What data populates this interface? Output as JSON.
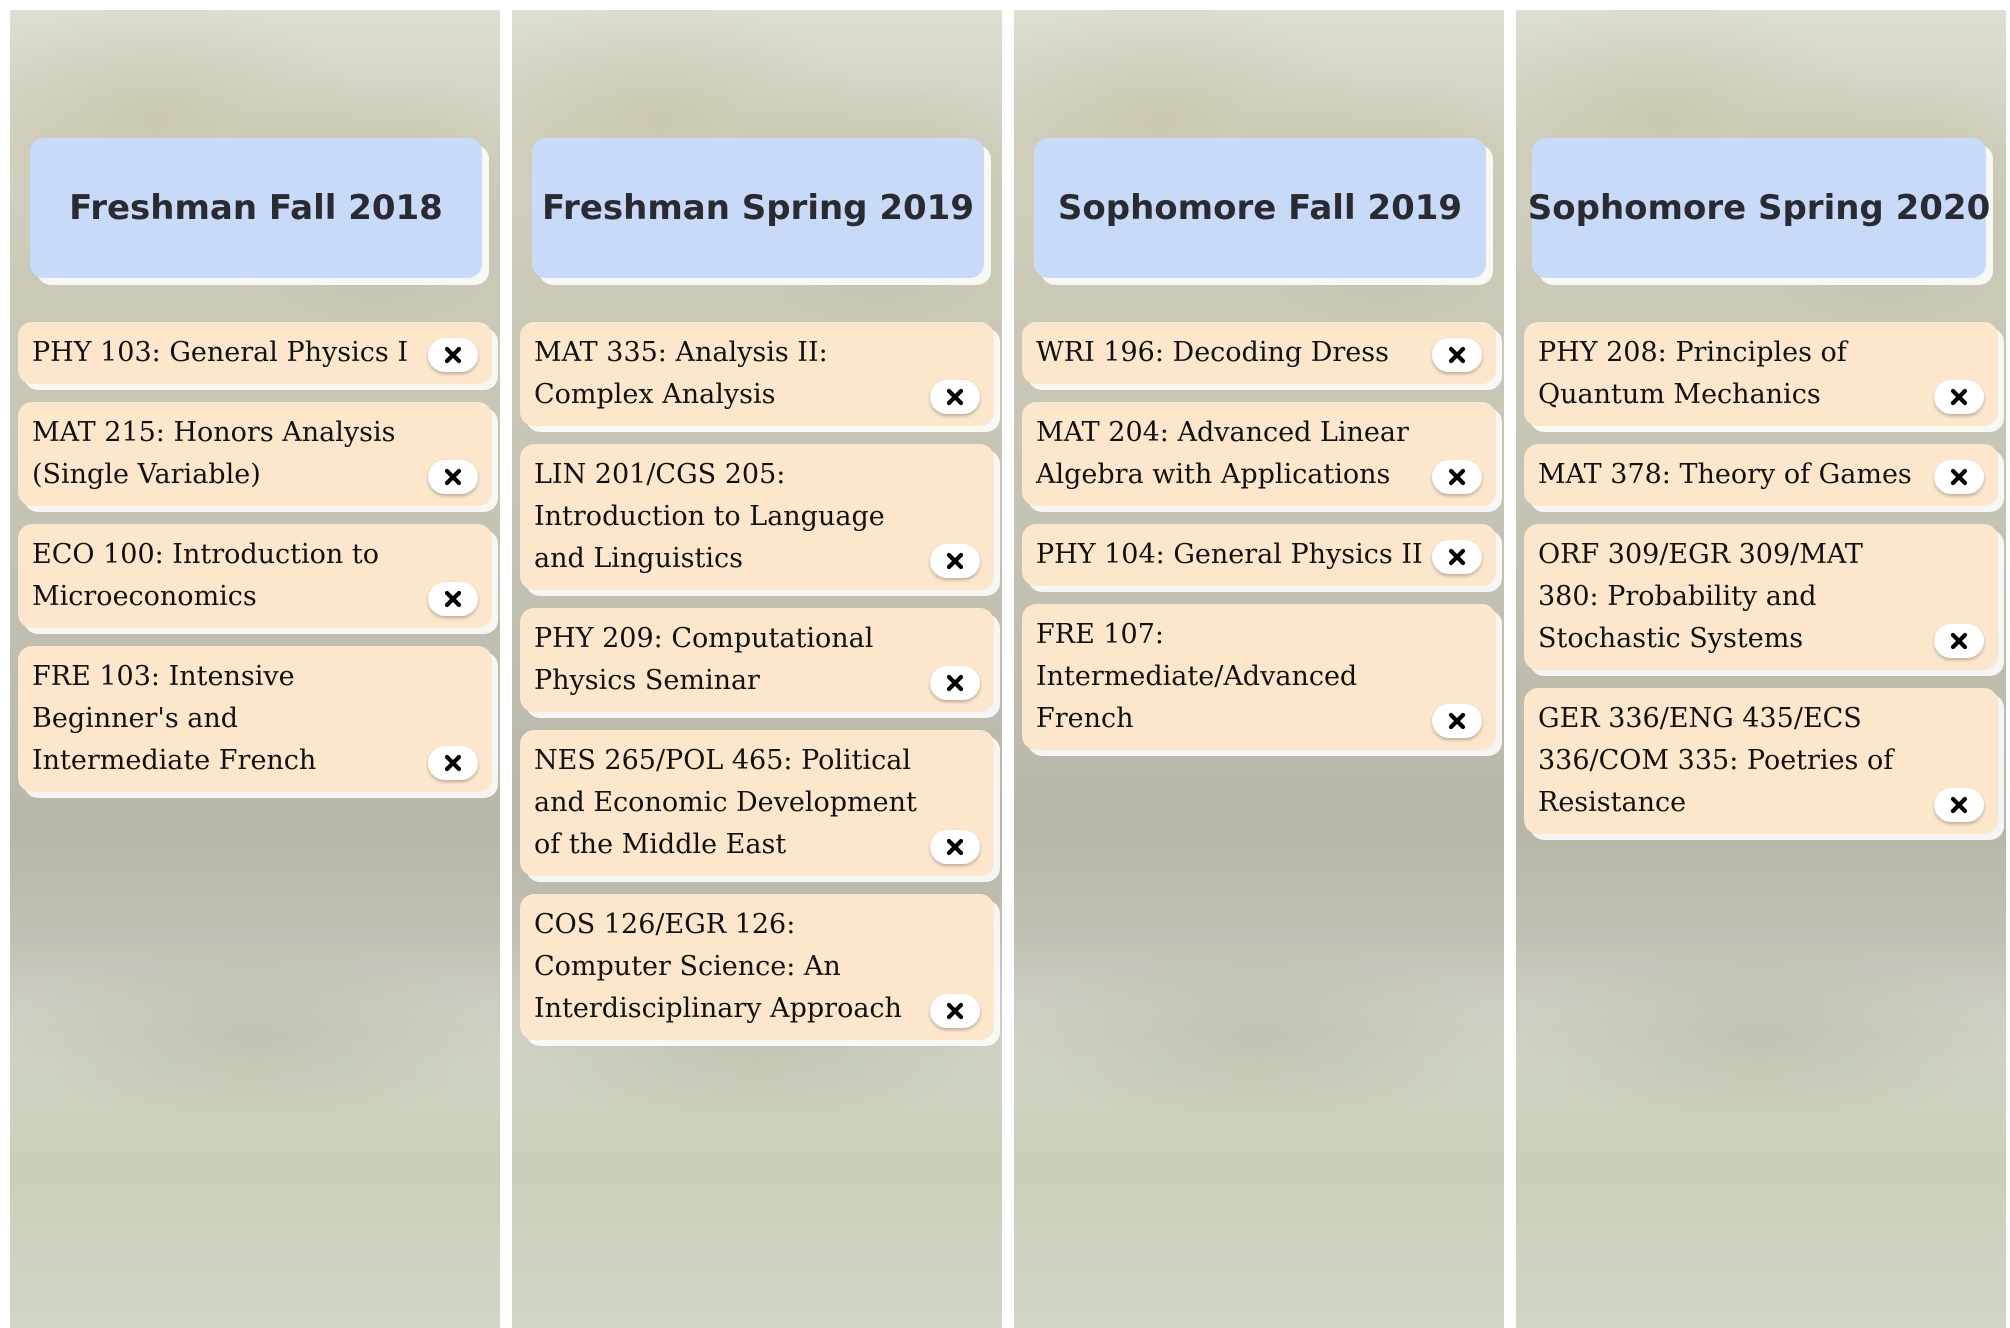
{
  "semesters": [
    {
      "title": "Freshman Fall 2018",
      "courses": [
        "PHY 103: General Physics I",
        "MAT 215: Honors Analysis (Single Variable)",
        "ECO 100: Introduction to Microeconomics",
        "FRE 103: Intensive Beginner's and Intermediate French"
      ]
    },
    {
      "title": "Freshman Spring 2019",
      "courses": [
        "MAT 335: Analysis II: Complex Analysis",
        "LIN 201/CGS 205: Introduction to Language and Linguistics",
        "PHY 209: Computational Physics Seminar",
        "NES 265/POL 465: Political and Economic Development of the Middle East",
        "COS 126/EGR 126: Computer Science: An Interdisciplinary Approach"
      ]
    },
    {
      "title": "Sophomore Fall 2019",
      "courses": [
        "WRI 196: Decoding Dress",
        "MAT 204: Advanced Linear Algebra with Applications",
        "PHY 104: General Physics II",
        "FRE 107: Intermediate/Advanced French"
      ]
    },
    {
      "title": "Sophomore Spring 2020",
      "courses": [
        "PHY 208: Principles of Quantum Mechanics",
        "MAT 378: Theory of Games",
        "ORF 309/EGR 309/MAT 380: Probability and Stochastic Systems",
        "GER 336/ENG 435/ECS 336/COM 335: Poetries of Resistance"
      ]
    }
  ],
  "icons": {
    "remove": "close-icon"
  },
  "colors": {
    "header_bg": "#c9daf8",
    "course_bg": "#fce6cc",
    "title_text": "#2a2a33"
  }
}
